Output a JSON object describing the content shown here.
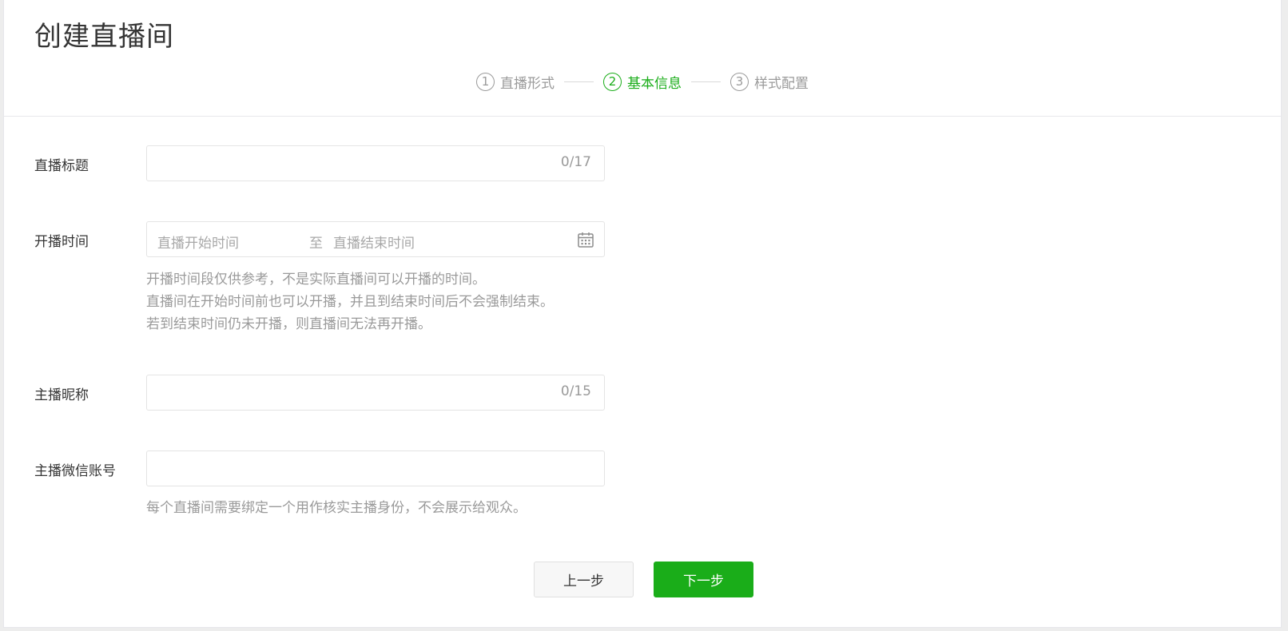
{
  "header": {
    "title": "创建直播间"
  },
  "steps": [
    {
      "num": "1",
      "label": "直播形式"
    },
    {
      "num": "2",
      "label": "基本信息"
    },
    {
      "num": "3",
      "label": "样式配置"
    }
  ],
  "form": {
    "title": {
      "label": "直播标题",
      "value": "",
      "counter": "0/17"
    },
    "time": {
      "label": "开播时间",
      "start_placeholder": "直播开始时间",
      "separator": "至",
      "end_placeholder": "直播结束时间",
      "hints": [
        "开播时间段仅供参考，不是实际直播间可以开播的时间。",
        "直播间在开始时间前也可以开播，并且到结束时间后不会强制结束。",
        "若到结束时间仍未开播，则直播间无法再开播。"
      ]
    },
    "nickname": {
      "label": "主播昵称",
      "value": "",
      "counter": "0/15"
    },
    "wechat": {
      "label": "主播微信账号",
      "value": "",
      "hint": "每个直播间需要绑定一个用作核实主播身份，不会展示给观众。"
    }
  },
  "actions": {
    "prev": "上一步",
    "next": "下一步"
  },
  "colors": {
    "accent": "#1aad19",
    "muted": "#9a9a9a"
  }
}
